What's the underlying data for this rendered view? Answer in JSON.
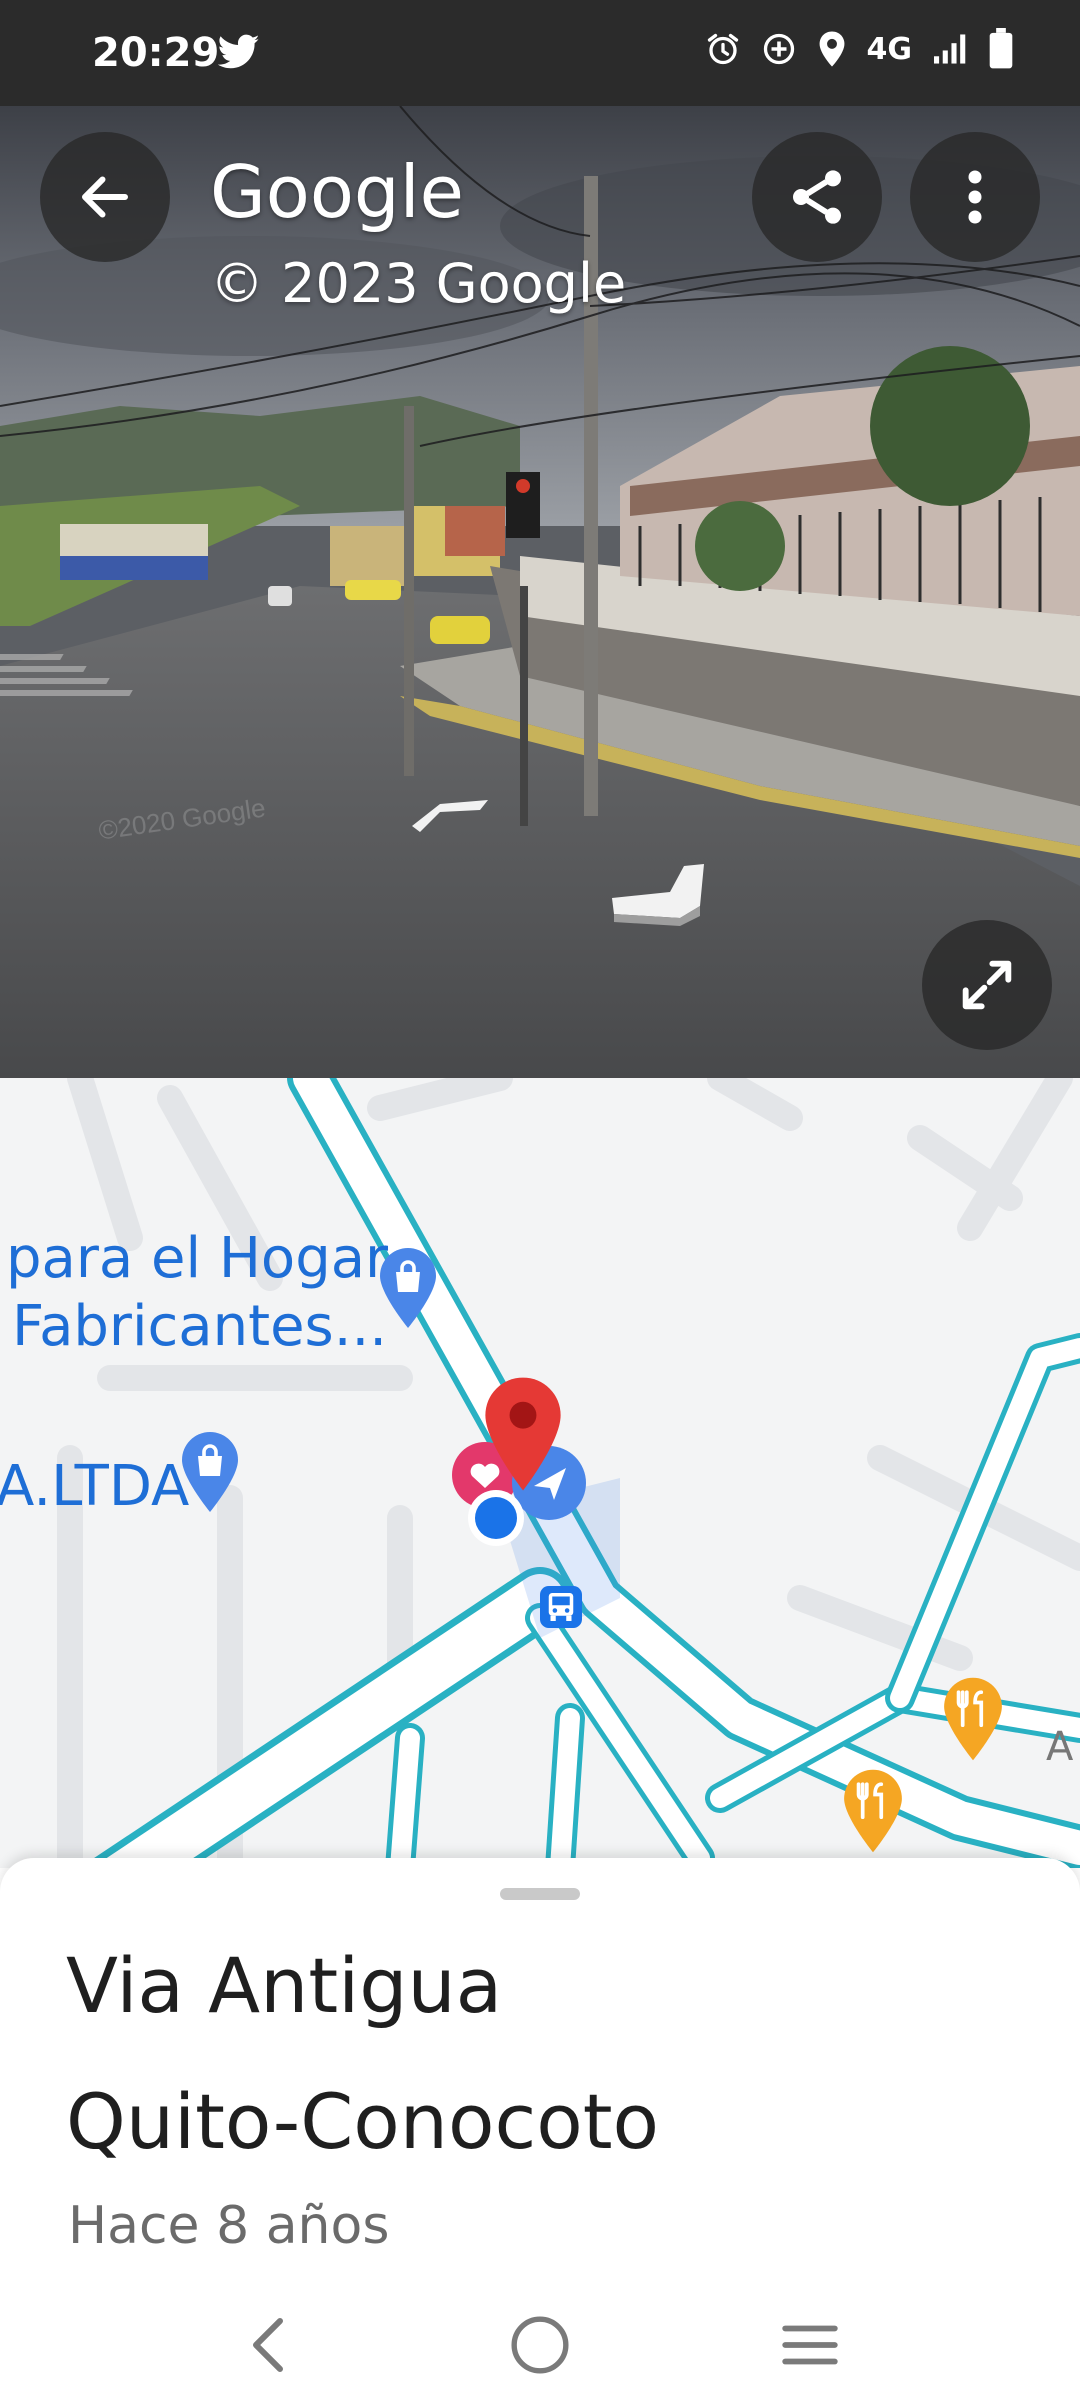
{
  "status_bar": {
    "time": "20:29",
    "network": "4G",
    "icons": [
      "twitter-icon",
      "alarm-icon",
      "data-saver-icon",
      "location-icon",
      "signal-icon",
      "battery-icon"
    ]
  },
  "street_view": {
    "title": "Google",
    "copyright": "© 2023 Google",
    "watermark": "©2020 Google",
    "buttons": [
      "back-icon",
      "share-icon",
      "more-icon",
      "expand-icon"
    ]
  },
  "map": {
    "labels": {
      "store_line1": "para el Hogar",
      "store_line2": "Fabricantes...",
      "ltda": "A.LTDA",
      "edge_letter": "A"
    },
    "colors": {
      "road_outline": "#29b1c3",
      "label_blue": "#1e6ed6",
      "pin_red": "#e53935",
      "restaurant_orange": "#f5a623"
    }
  },
  "place": {
    "title_line1": "Via Antigua",
    "title_line2": "Quito-Conocoto",
    "subtitle": "Hace 8 años"
  },
  "nav_bar": {
    "buttons": [
      "back-nav-icon",
      "home-nav-icon",
      "recents-nav-icon"
    ]
  }
}
